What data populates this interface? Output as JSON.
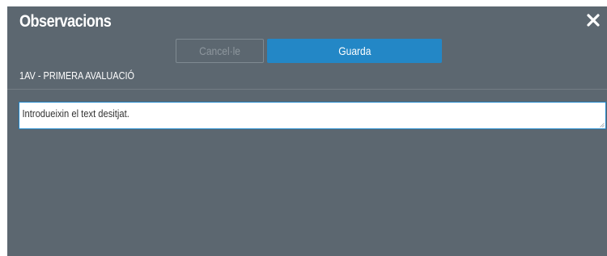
{
  "dialog": {
    "title": "Observacions",
    "close_icon": "close-icon"
  },
  "actions": {
    "cancel_label": "Cancel·le",
    "save_label": "Guarda"
  },
  "section": {
    "label": "1AV - PRIMERA AVALUACIÓ"
  },
  "observation_field": {
    "value": "Introdueixin el text desitjat."
  },
  "colors": {
    "background": "#5c6770",
    "primary": "#2387c6",
    "focus_border": "#1f86c9"
  }
}
